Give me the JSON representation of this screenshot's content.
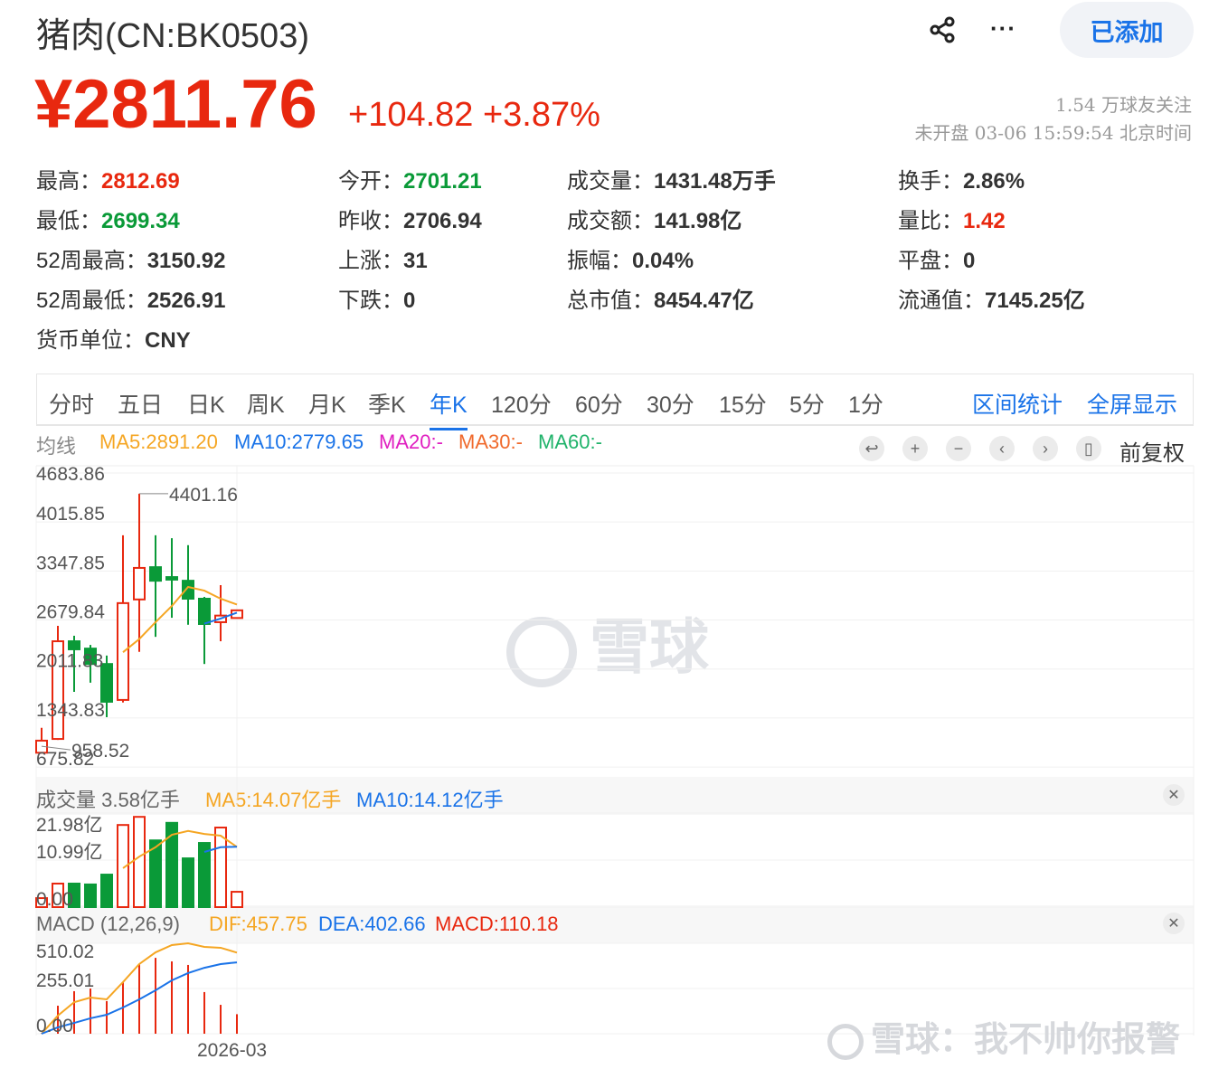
{
  "header": {
    "title": "猪肉(CN:BK0503)",
    "price": "¥2811.76",
    "change": "+104.82",
    "change_pct": "+3.87%",
    "added_label": "已添加",
    "followers": "1.54 万球友关注",
    "market_status": "未开盘 03-06 15:59:54 北京时间"
  },
  "quote": [
    [
      {
        "k": "最高：",
        "v": "2812.69",
        "c": "red"
      },
      {
        "k": "今开：",
        "v": "2701.21",
        "c": "green"
      },
      {
        "k": "成交量：",
        "v": "1431.48万手",
        "c": ""
      },
      {
        "k": "换手：",
        "v": "2.86%",
        "c": ""
      }
    ],
    [
      {
        "k": "最低：",
        "v": "2699.34",
        "c": "green"
      },
      {
        "k": "昨收：",
        "v": "2706.94",
        "c": ""
      },
      {
        "k": "成交额：",
        "v": "141.98亿",
        "c": ""
      },
      {
        "k": "量比：",
        "v": "1.42",
        "c": "red"
      }
    ],
    [
      {
        "k": "52周最高：",
        "v": "3150.92",
        "c": ""
      },
      {
        "k": "上涨：",
        "v": "31",
        "c": ""
      },
      {
        "k": "振幅：",
        "v": "0.04%",
        "c": ""
      },
      {
        "k": "平盘：",
        "v": "0",
        "c": ""
      }
    ],
    [
      {
        "k": "52周最低：",
        "v": "2526.91",
        "c": ""
      },
      {
        "k": "下跌：",
        "v": "0",
        "c": ""
      },
      {
        "k": "总市值：",
        "v": "8454.47亿",
        "c": ""
      },
      {
        "k": "流通值：",
        "v": "7145.25亿",
        "c": ""
      }
    ],
    [
      {
        "k": "货币单位：",
        "v": "CNY",
        "c": ""
      }
    ]
  ],
  "tabs": [
    "分时",
    "五日",
    "日K",
    "周K",
    "月K",
    "季K",
    "年K",
    "120分",
    "60分",
    "30分",
    "15分",
    "5分",
    "1分"
  ],
  "active_tab": "年K",
  "tab_actions": [
    "区间统计",
    "全屏显示"
  ],
  "ma": {
    "label": "均线",
    "ma5": "MA5:2891.20",
    "ma10": "MA10:2779.65",
    "ma20": "MA20:-",
    "ma30": "MA30:-",
    "ma60": "MA60:-"
  },
  "toolbar": {
    "icons": [
      "reset-icon",
      "zoom-in-icon",
      "zoom-out-icon",
      "left-icon",
      "right-icon",
      "candle-icon"
    ],
    "adjust": "前复权"
  },
  "colors": {
    "up": "#e8280f",
    "down": "#0a9a38",
    "ma5": "#f5a623",
    "ma10": "#1a73e8",
    "ma20": "#e020c0",
    "ma30": "#f06a2c",
    "ma60": "#21b36b"
  },
  "watermark": "雪球",
  "footer_watermark": "雪球：我不帅你报警",
  "chart_data": [
    {
      "type": "candlestick",
      "title": "年K",
      "yticks": [
        "4683.86",
        "4015.85",
        "3347.85",
        "2679.84",
        "2011.83",
        "1343.83",
        "675.82"
      ],
      "ytick_values": [
        4683.86,
        4015.85,
        3347.85,
        2679.84,
        2011.83,
        1343.83,
        675.82
      ],
      "max_label": "4401.16",
      "min_label": "958.52",
      "ohlc": [
        [
          870,
          1035,
          1210,
          958.52
        ],
        [
          1058,
          2390,
          2600,
          1045
        ],
        [
          2390,
          2280,
          2465,
          1700
        ],
        [
          2290,
          2080,
          2340,
          1825
        ],
        [
          2080,
          1565,
          2195,
          1355
        ],
        [
          1590,
          2910,
          3835,
          1555
        ],
        [
          2960,
          3390,
          4401.16,
          2245
        ],
        [
          3400,
          3215,
          3835,
          2450
        ],
        [
          3265,
          3230,
          3795,
          2710
        ],
        [
          3215,
          2970,
          3700,
          2615
        ],
        [
          2970,
          2625,
          2995,
          2080
        ],
        [
          2650,
          2740,
          3155,
          2390
        ],
        [
          2706.94,
          2811.76,
          2812.69,
          2699.34
        ]
      ],
      "ma5": [
        null,
        null,
        null,
        null,
        null,
        2240,
        2420,
        2650,
        2870,
        3130,
        3080,
        2970,
        2891.2
      ],
      "ma10": [
        null,
        null,
        null,
        null,
        null,
        null,
        null,
        null,
        null,
        null,
        2630,
        2700,
        2779.65
      ]
    },
    {
      "type": "bar",
      "title": "成交量",
      "label": "成交量 3.58亿手",
      "ma5_label": "MA5:14.07亿手",
      "ma10_label": "MA10:14.12亿手",
      "yticks": [
        "21.98亿",
        "10.99亿",
        "0.00"
      ],
      "ytick_values": [
        21.98,
        10.99,
        0
      ],
      "values": [
        2.1,
        5.5,
        5.5,
        5.3,
        7.6,
        19.2,
        21.1,
        15.6,
        19.7,
        11.4,
        15.0,
        18.6,
        3.58
      ],
      "up": [
        true,
        true,
        false,
        false,
        false,
        true,
        true,
        false,
        false,
        false,
        false,
        true,
        true
      ],
      "ma5": [
        null,
        null,
        null,
        null,
        null,
        9.1,
        11.8,
        14.0,
        16.9,
        17.8,
        17.1,
        16.7,
        14.07
      ],
      "ma10": [
        null,
        null,
        null,
        null,
        null,
        null,
        null,
        null,
        null,
        null,
        12.9,
        14.0,
        14.12
      ]
    },
    {
      "type": "macd",
      "label": "MACD (12,26,9)",
      "dif_label": "DIF:457.75",
      "dea_label": "DEA:402.66",
      "macd_label": "MACD:110.18",
      "yticks": [
        "510.02",
        "255.01",
        "0.00"
      ],
      "ytick_values": [
        510.02,
        255.01,
        0
      ],
      "xlabel": "2026-03",
      "macd": [
        2,
        158,
        240,
        255,
        184,
        291,
        393,
        428,
        408,
        388,
        235,
        163,
        110.18
      ],
      "dif": [
        0,
        102,
        178,
        204,
        194,
        291,
        393,
        459,
        500,
        510,
        490,
        485,
        457.75
      ],
      "dea": [
        0,
        36,
        61,
        87,
        107,
        148,
        194,
        245,
        301,
        342,
        372,
        393,
        402.66
      ]
    }
  ]
}
